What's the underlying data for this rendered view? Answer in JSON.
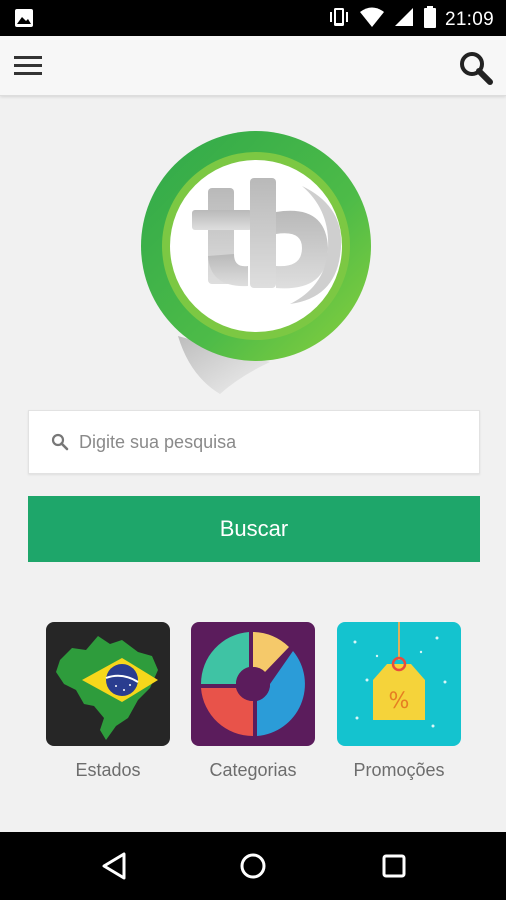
{
  "status_bar": {
    "time": "21:09",
    "icons": [
      "image-icon",
      "vibrate-icon",
      "wifi-icon",
      "signal-icon",
      "battery-icon"
    ]
  },
  "app_bar": {
    "menu_icon": "hamburger-menu-icon",
    "search_icon": "search-icon"
  },
  "logo": {
    "text": "tb",
    "ring_color": "#3bb54a"
  },
  "search": {
    "placeholder": "Digite sua pesquisa",
    "value": ""
  },
  "buscar_button": {
    "label": "Buscar",
    "color": "#1ea66a"
  },
  "tiles": [
    {
      "label": "Estados",
      "icon": "brazil-map-icon"
    },
    {
      "label": "Categorias",
      "icon": "categories-donut-icon"
    },
    {
      "label": "Promoções",
      "icon": "price-tag-icon"
    }
  ],
  "nav_bar": {
    "icons": [
      "back-icon",
      "home-icon",
      "recents-icon"
    ]
  }
}
